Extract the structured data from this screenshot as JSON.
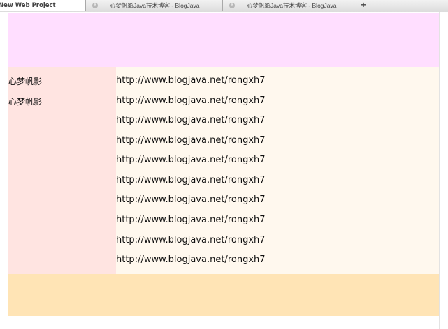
{
  "tabs": [
    {
      "label": "New Web Project",
      "active": true
    },
    {
      "label": "心梦帆影Java技术博客 - BlogJava",
      "active": false
    },
    {
      "label": "心梦帆影Java技术博客 - BlogJava",
      "active": false
    }
  ],
  "new_tab_label": "+",
  "close_glyph": "×",
  "sidebar": {
    "items": [
      "心梦帆影",
      "心梦帆影"
    ]
  },
  "content": {
    "links": [
      "http://www.blogjava.net/rongxh7",
      "http://www.blogjava.net/rongxh7",
      "http://www.blogjava.net/rongxh7",
      "http://www.blogjava.net/rongxh7",
      "http://www.blogjava.net/rongxh7",
      "http://www.blogjava.net/rongxh7",
      "http://www.blogjava.net/rongxh7",
      "http://www.blogjava.net/rongxh7",
      "http://www.blogjava.net/rongxh7",
      "http://www.blogjava.net/rongxh7"
    ]
  },
  "colors": {
    "header": "#ffdeff",
    "sidebar": "#ffe4e1",
    "content": "#fff8ee",
    "footer": "#ffe4b5"
  }
}
